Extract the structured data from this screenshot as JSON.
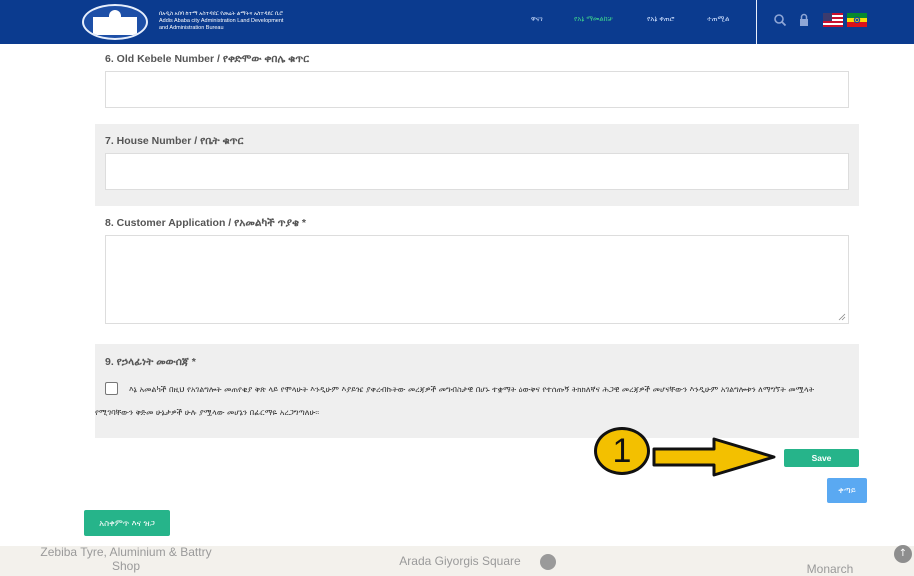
{
  "header": {
    "org_lines": [
      "በአዲስ አበባ ከተማ አስተዳደር የመሬት ልማትና አስተዳደር ቢሮ",
      "Addis Ababa city Administration Land Development",
      "and Administration Bureau"
    ],
    "nav": [
      {
        "label": "ዋናገ",
        "active": false
      },
      {
        "label": "የአኔ ማመልከቻ",
        "active": true
      },
      {
        "label": "የአኔ ቀጠሮ",
        "active": false
      },
      {
        "label": "ተጠሚል",
        "active": false
      }
    ],
    "icons": [
      "search-icon",
      "lock-icon",
      "us-flag-icon",
      "ethiopia-flag-icon"
    ]
  },
  "form": {
    "fields": [
      {
        "label": "6. Old Kebele Number / የቀድሞው ቀበሌ ቁጥር",
        "value": ""
      },
      {
        "label": "7. House Number / የቤት ቁጥር",
        "value": ""
      },
      {
        "label": "8. Customer Application / የአመልካች ጥያቄ *",
        "value": ""
      }
    ],
    "declaration": {
      "label": "9. የኃላፊነት መውሰጃ *",
      "text": "እኔ አመልካች በዚህ የአገልግሎት መጠየቂያ ቅጽ ላይ የሞላሁት እንዲሁም እያይዤ ያቀረብኩትው መረጃዎች መግብስታዊ በሆኑ ተቋማት ዕውቅና የተሰጡኝ ትክክለኛና ሕጋዊ መረጃዎች መሆናቸውን እንዲሁም አገልግሎቱን ለማግኘት መሟላት የሚገባቸውን ቅድመ ሁኔታዎች ሁሉ ያሟላው መሆኔን በፊርማዬ አረጋግጣለሁ፡፡",
      "checked": false
    },
    "save_label": "Save",
    "next_label": "ቀጣይ",
    "terms_label": "አስቀምጥ እና ዝጋ"
  },
  "annotation": {
    "number": "1"
  },
  "map": {
    "labels": [
      "Zebiba Tyre, Aluminium & Battry Shop",
      "Arada Giyorgis Square",
      "Monarch"
    ]
  },
  "colors": {
    "header_bg": "#0b3b8f",
    "accent_green": "#26b48a",
    "accent_blue": "#5aa9f2",
    "annotation_yellow": "#f3c000"
  }
}
